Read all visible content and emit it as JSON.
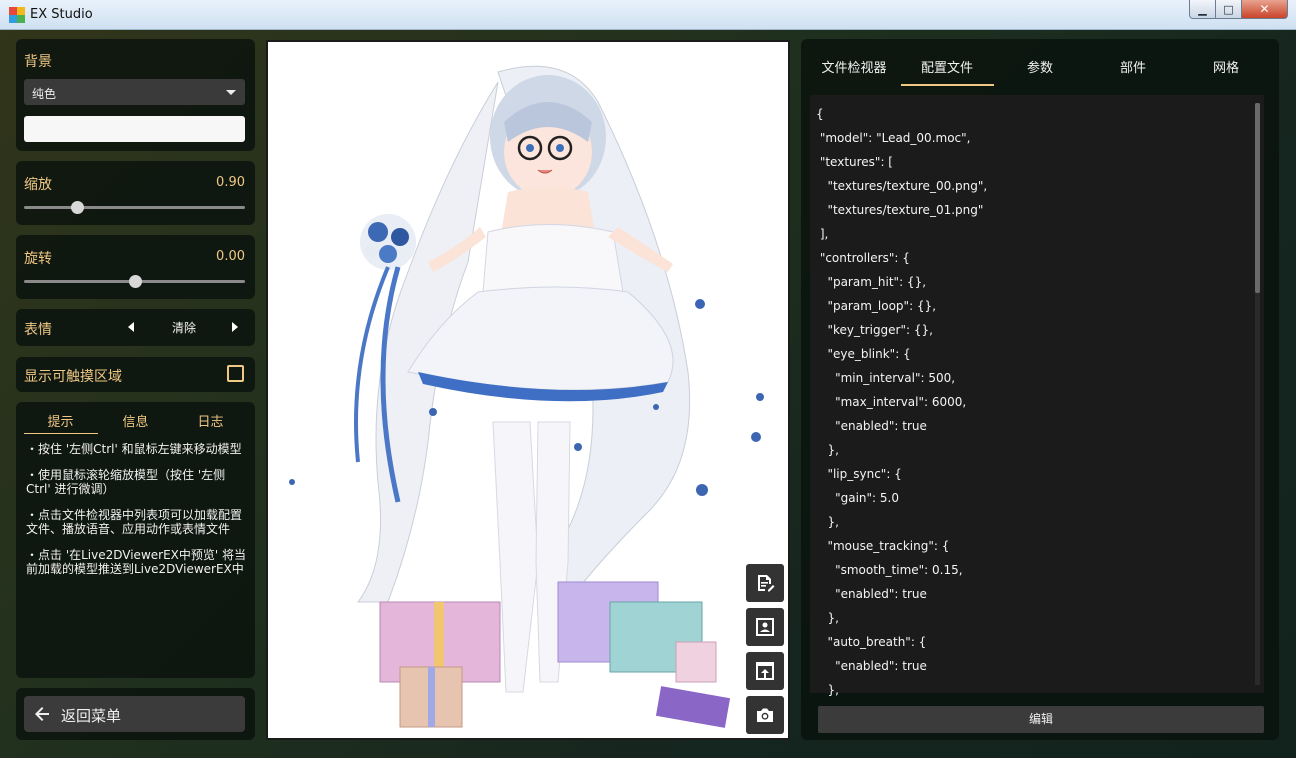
{
  "window": {
    "title": "EX Studio",
    "min_glyph": "▁",
    "max_glyph": "□",
    "close_glyph": "✕"
  },
  "left": {
    "background": {
      "label": "背景",
      "dropdown_value": "纯色",
      "color": "#f7f7f7"
    },
    "scale": {
      "label": "缩放",
      "value": "0.90",
      "fraction": 0.24
    },
    "rotation": {
      "label": "旋转",
      "value": "0.00",
      "fraction": 0.5
    },
    "expression": {
      "label": "表情",
      "value": "清除"
    },
    "touch_area": {
      "label": "显示可触摸区域",
      "checked": false
    },
    "subtabs": [
      "提示",
      "信息",
      "日志"
    ],
    "tips": [
      "・按住 '左侧Ctrl' 和鼠标左键来移动模型",
      "・使用鼠标滚轮缩放模型（按住 '左侧Ctrl' 进行微调）",
      "・点击文件检视器中列表项可以加载配置文件、播放语音、应用动作或表情文件",
      "・点击 '在Live2DViewerEX中预览' 将当前加载的模型推送到Live2DViewerEX中"
    ],
    "back_button": "返回菜单"
  },
  "canvas": {
    "tools": [
      "edit-icon",
      "portrait-icon",
      "push-icon",
      "camera-icon"
    ]
  },
  "right": {
    "tabs": [
      "文件检视器",
      "配置文件",
      "参数",
      "部件",
      "网格"
    ],
    "active_tab": "配置文件",
    "code_lines": [
      "{",
      " \"model\": \"Lead_00.moc\",",
      " \"textures\": [",
      "   \"textures/texture_00.png\",",
      "   \"textures/texture_01.png\"",
      " ],",
      " \"controllers\": {",
      "   \"param_hit\": {},",
      "   \"param_loop\": {},",
      "   \"key_trigger\": {},",
      "   \"eye_blink\": {",
      "     \"min_interval\": 500,",
      "     \"max_interval\": 6000,",
      "     \"enabled\": true",
      "   },",
      "   \"lip_sync\": {",
      "     \"gain\": 5.0",
      "   },",
      "   \"mouse_tracking\": {",
      "     \"smooth_time\": 0.15,",
      "     \"enabled\": true",
      "   },",
      "   \"auto_breath\": {",
      "     \"enabled\": true",
      "   },"
    ],
    "edit_button": "编辑"
  }
}
